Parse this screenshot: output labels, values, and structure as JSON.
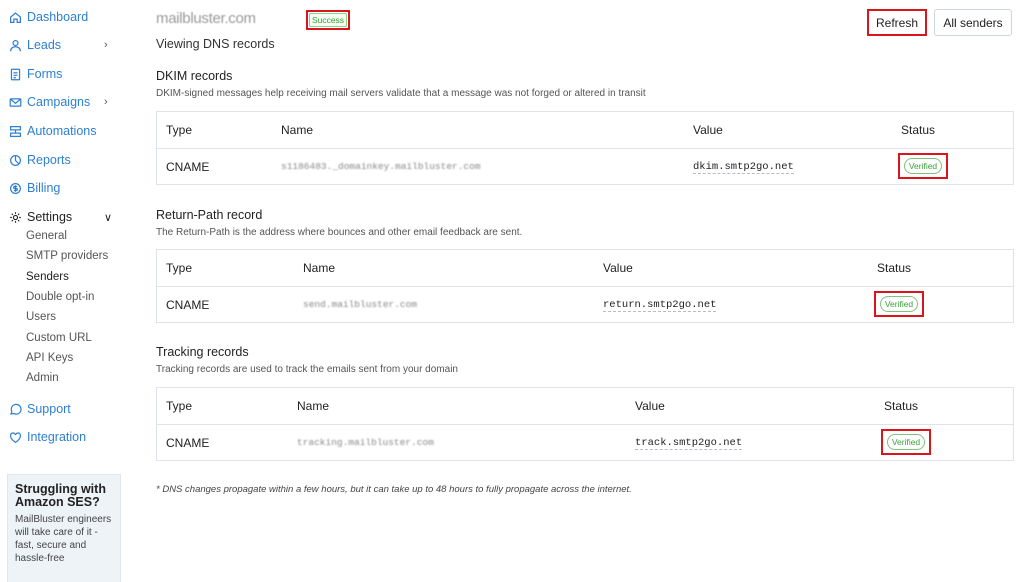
{
  "sidebar": {
    "items": [
      {
        "label": "Dashboard",
        "icon": "home-icon"
      },
      {
        "label": "Leads",
        "icon": "user-icon"
      },
      {
        "label": "Forms",
        "icon": "form-icon"
      },
      {
        "label": "Campaigns",
        "icon": "mail-icon"
      },
      {
        "label": "Automations",
        "icon": "automation-icon"
      },
      {
        "label": "Reports",
        "icon": "reports-icon"
      },
      {
        "label": "Billing",
        "icon": "billing-icon"
      },
      {
        "label": "Settings",
        "icon": "gear-icon"
      },
      {
        "label": "Support",
        "icon": "support-icon"
      },
      {
        "label": "Integration",
        "icon": "integration-icon"
      }
    ],
    "settings_sub": [
      "General",
      "SMTP providers",
      "Senders",
      "Double opt-in",
      "Users",
      "Custom URL",
      "API Keys",
      "Admin"
    ],
    "promo": {
      "title": "Struggling with Amazon SES?",
      "text": "MailBluster engineers will take care of it - fast, secure and hassle-free"
    }
  },
  "header": {
    "domain": "mailbluster.com",
    "status_badge": "Success",
    "subtitle": "Viewing DNS records",
    "refresh_label": "Refresh",
    "all_senders_label": "All senders"
  },
  "columns": {
    "type": "Type",
    "name": "Name",
    "value": "Value",
    "status": "Status"
  },
  "dkim": {
    "title": "DKIM records",
    "description": "DKIM-signed messages help receiving mail servers validate that a message was not forged or altered in transit",
    "row": {
      "type": "CNAME",
      "name": "s1186483._domainkey.mailbluster.com",
      "value": "dkim.smtp2go.net",
      "status": "Verified"
    }
  },
  "return_path": {
    "title": "Return-Path record",
    "description": "The Return-Path is the address where bounces and other email feedback are sent.",
    "row": {
      "type": "CNAME",
      "name": "send.mailbluster.com",
      "value": "return.smtp2go.net",
      "status": "Verified"
    }
  },
  "tracking": {
    "title": "Tracking records",
    "description": "Tracking records are used to track the emails sent from your domain",
    "row": {
      "type": "CNAME",
      "name": "tracking.mailbluster.com",
      "value": "track.smtp2go.net",
      "status": "Verified"
    }
  },
  "footnote": "* DNS changes propagate within a few hours, but it can take up to 48 hours to fully propagate across the internet.",
  "colors": {
    "link": "#2d7fd1",
    "success": "#3aa23a",
    "highlight": "#d8161c"
  }
}
